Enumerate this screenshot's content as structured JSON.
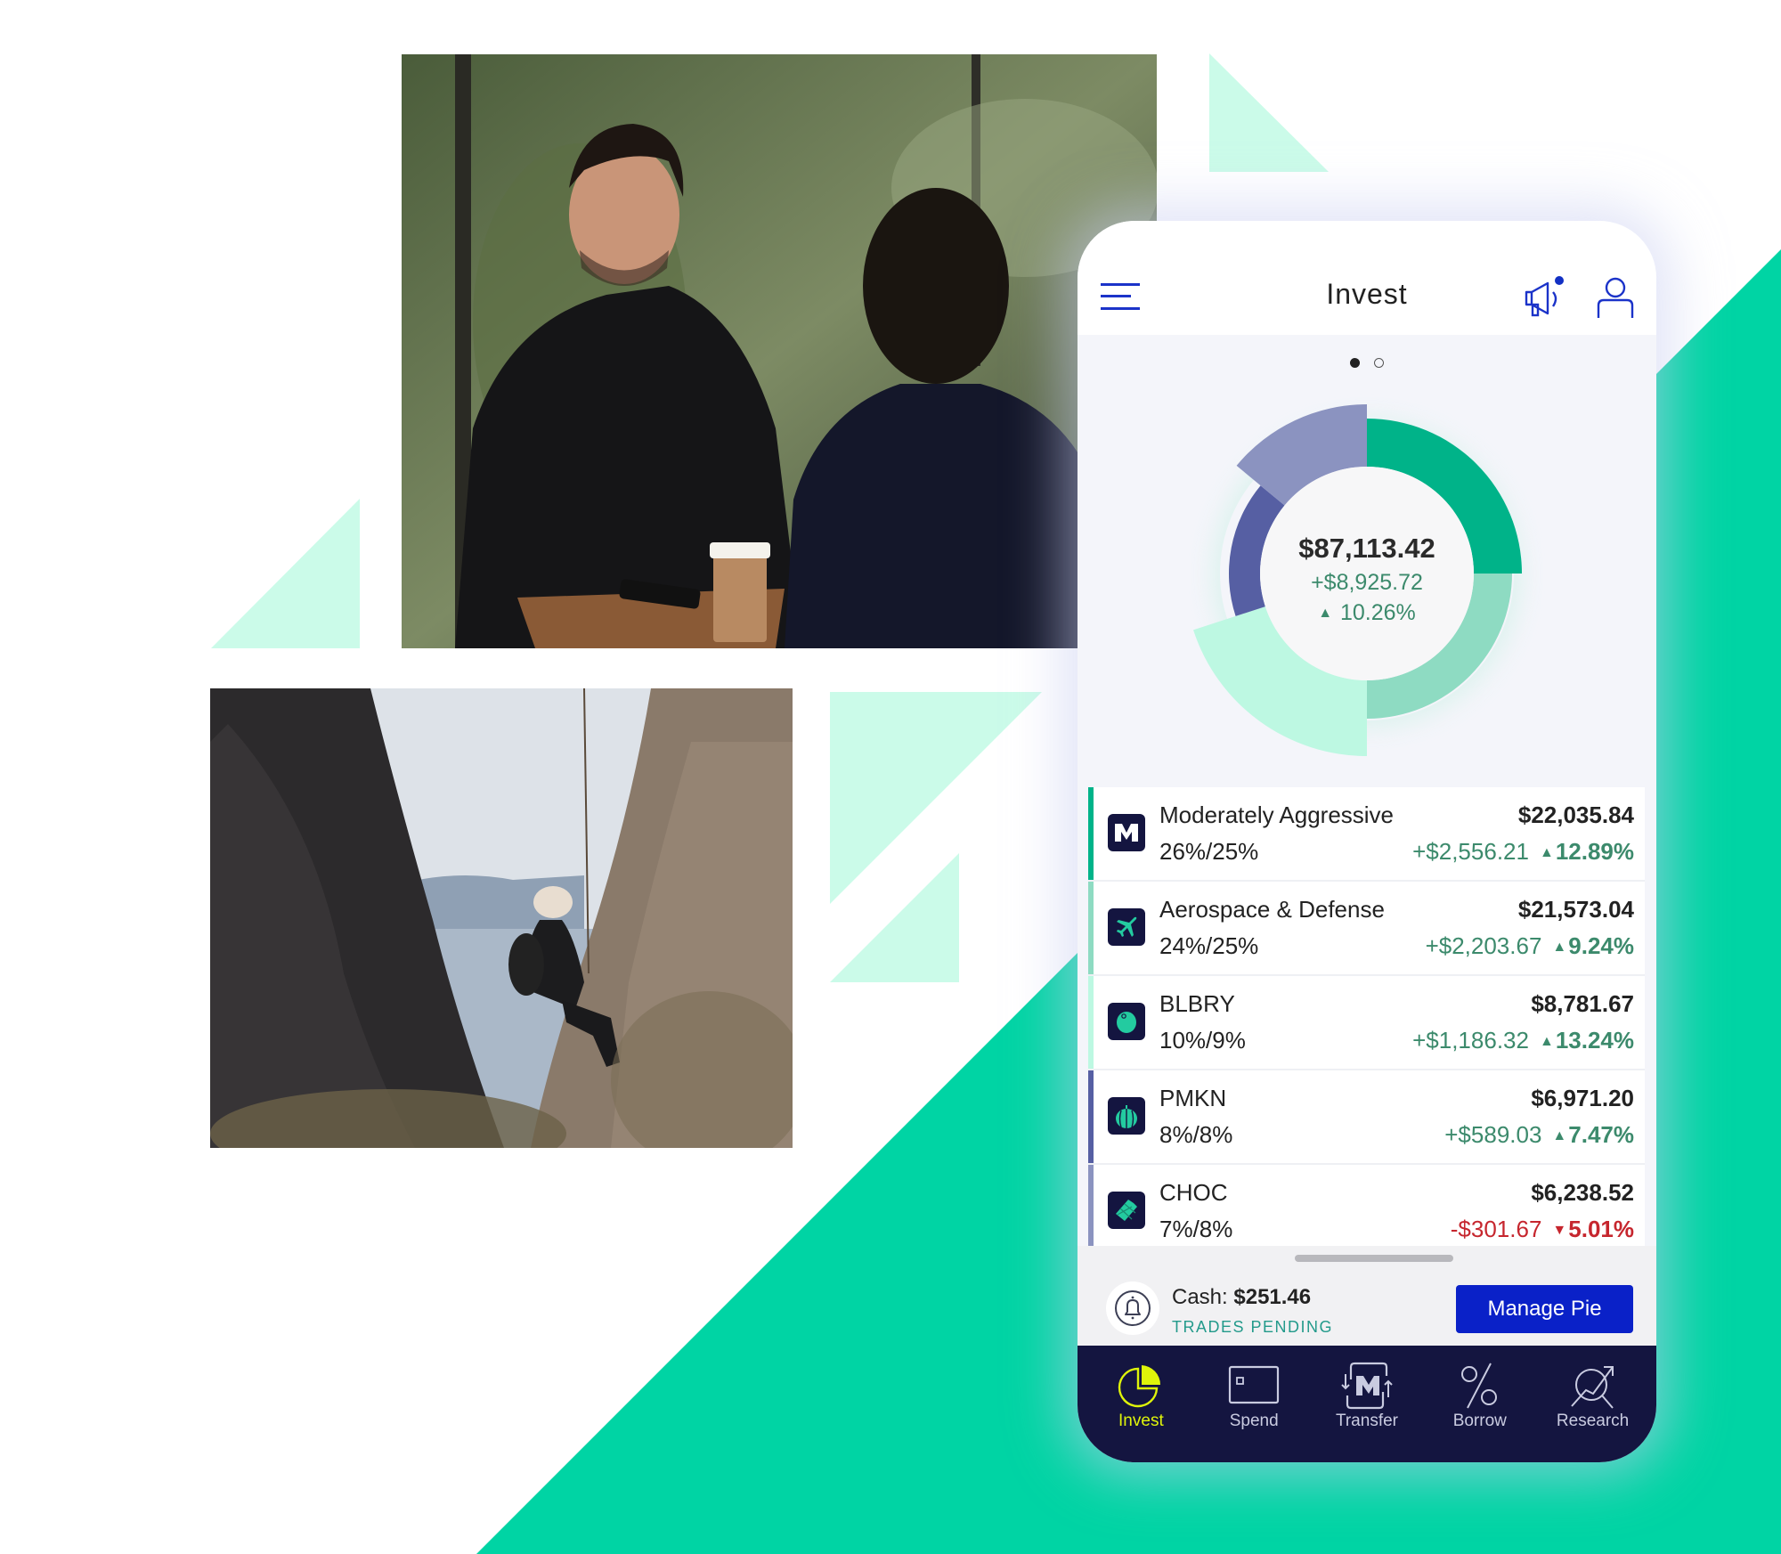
{
  "background": {
    "colors": {
      "primary_green": "#00d4a4",
      "light_mint": "#cbfbe9"
    }
  },
  "photos": [
    {
      "name": "meeting-photo",
      "description": "Two people talking at an outdoor cafe table"
    },
    {
      "name": "climber-photo",
      "description": "Woman rappelling between rock cliffs above the sea"
    }
  ],
  "app": {
    "header": {
      "title": "Invest",
      "menu_icon": "hamburger-icon",
      "announcement_icon": "megaphone-icon",
      "announcement_badge": true,
      "profile_icon": "person-icon"
    },
    "pager": {
      "pages": 2,
      "active": 1
    },
    "portfolio": {
      "total_value": "$87,113.42",
      "total_gain": "+$8,925.72",
      "total_gain_pct": "10.26%",
      "direction": "up"
    },
    "holdings": [
      {
        "name": "Moderately Aggressive",
        "allocation": "26%/25%",
        "value": "$22,035.84",
        "change": "+$2,556.21",
        "change_pct": "12.89%",
        "direction": "up",
        "icon": "m1-logo-icon",
        "color": "#00b389"
      },
      {
        "name": "Aerospace & Defense",
        "allocation": "24%/25%",
        "value": "$21,573.04",
        "change": "+$2,203.67",
        "change_pct": "9.24%",
        "direction": "up",
        "icon": "airplane-icon",
        "color": "#8edbc2"
      },
      {
        "name": "BLBRY",
        "allocation": "10%/9%",
        "value": "$8,781.67",
        "change": "+$1,186.32",
        "change_pct": "13.24%",
        "direction": "up",
        "icon": "blueberry-icon",
        "color": "#bdf8e2"
      },
      {
        "name": "PMKN",
        "allocation": "8%/8%",
        "value": "$6,971.20",
        "change": "+$589.03",
        "change_pct": "7.47%",
        "direction": "up",
        "icon": "pumpkin-icon",
        "color": "#565fa3"
      },
      {
        "name": "CHOC",
        "allocation": "7%/8%",
        "value": "$6,238.52",
        "change": "-$301.67",
        "change_pct": "5.01%",
        "direction": "down",
        "icon": "chocolate-bar-icon",
        "color": "#8b93c0"
      }
    ],
    "cash": {
      "label": "Cash:",
      "amount": "$251.46",
      "status": "TRADES PENDING",
      "icon": "bell-icon"
    },
    "manage_button": "Manage Pie",
    "nav": [
      {
        "label": "Invest",
        "icon": "pie-chart-icon",
        "active": true
      },
      {
        "label": "Spend",
        "icon": "card-icon",
        "active": false
      },
      {
        "label": "Transfer",
        "icon": "transfer-icon",
        "active": false
      },
      {
        "label": "Borrow",
        "icon": "percent-icon",
        "active": false
      },
      {
        "label": "Research",
        "icon": "research-icon",
        "active": false
      }
    ],
    "colors": {
      "accent_blue": "#0a21c8",
      "gain_green": "#3c8a6c",
      "loss_red": "#c6262e",
      "nav_bg": "#141540",
      "nav_active": "#dff40a"
    }
  },
  "chart_data": {
    "type": "pie",
    "title": "",
    "center_label": "$87,113.42",
    "slices": [
      {
        "name": "Moderately Aggressive",
        "actual_pct": 26,
        "target_pct": 25,
        "color": "#00b389"
      },
      {
        "name": "Aerospace & Defense",
        "actual_pct": 24,
        "target_pct": 25,
        "color": "#8edbc2"
      },
      {
        "name": "BLBRY",
        "actual_pct": 10,
        "target_pct": 9,
        "color": "#bdf8e2"
      },
      {
        "name": "PMKN",
        "actual_pct": 8,
        "target_pct": 8,
        "color": "#565fa3"
      },
      {
        "name": "CHOC",
        "actual_pct": 7,
        "target_pct": 8,
        "color": "#8b93c0"
      }
    ]
  }
}
